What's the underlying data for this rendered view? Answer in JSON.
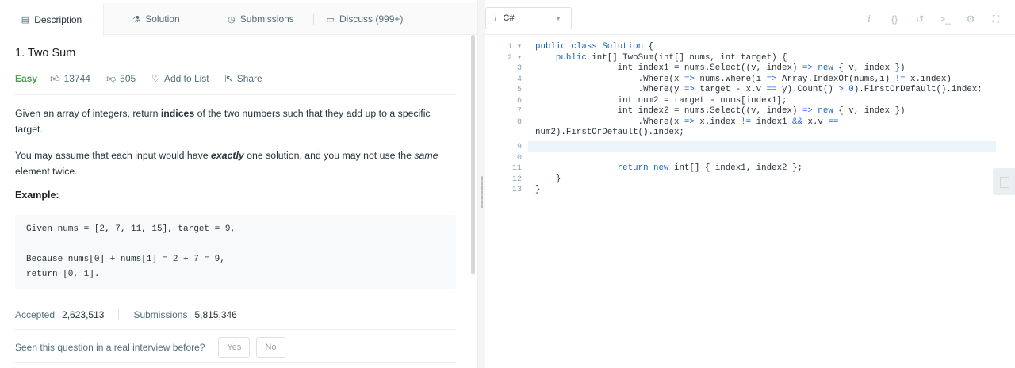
{
  "tabs": [
    {
      "label": "Description",
      "icon": "description-icon"
    },
    {
      "label": "Solution",
      "icon": "flask-icon"
    },
    {
      "label": "Submissions",
      "icon": "clock-icon"
    },
    {
      "label": "Discuss (999+)",
      "icon": "discuss-icon"
    }
  ],
  "problem": {
    "title": "1. Two Sum",
    "difficulty": "Easy",
    "likes": "13744",
    "dislikes": "505",
    "add_to_list": "Add to List",
    "share": "Share",
    "desc1_a": "Given an array of integers, return ",
    "desc1_b": "indices",
    "desc1_c": " of the two numbers such that they add up to a specific target.",
    "desc2_a": "You may assume that each input would have ",
    "desc2_b": "exactly",
    "desc2_c": " one solution, and you may not use the ",
    "desc2_d": "same",
    "desc2_e": " element twice.",
    "example_heading": "Example:",
    "example_lines": [
      "Given nums = [2, 7, 11, 15], target = 9,",
      "Because nums[0] + nums[1] = 2 + 7 = 9,",
      "return [0, 1]."
    ]
  },
  "stats": {
    "accepted_label": "Accepted",
    "accepted_value": "2,623,513",
    "submissions_label": "Submissions",
    "submissions_value": "5,815,346"
  },
  "interview": {
    "question": "Seen this question in a real interview before?",
    "yes": "Yes",
    "no": "No"
  },
  "editor": {
    "language": "C#",
    "gutter": [
      "1",
      "2",
      "3",
      "4",
      "5",
      "6",
      "7",
      "8",
      "",
      "9",
      "10",
      "11",
      "12",
      "13"
    ],
    "lines": [
      "public class Solution {",
      "    public int[] TwoSum(int[] nums, int target) {",
      "                int index1 = nums.Select((v, index) => new { v, index })",
      "                    .Where(x => nums.Where(i => Array.IndexOf(nums,i) != x.index)",
      "                    .Where(y => target - x.v == y).Count() > 0).FirstOrDefault().index;",
      "                int num2 = target - nums[index1];",
      "                int index2 = nums.Select((v, index) => new { v, index })",
      "                    .Where(x => x.index != index1 && x.v ==",
      "num2).FirstOrDefault().index;",
      "",
      "",
      "                return new int[] { index1, index2 };",
      "    }",
      "}"
    ]
  },
  "colors": {
    "easy": "#43a047",
    "keyword": "#1565c0",
    "active_line": "#edf5fc"
  }
}
